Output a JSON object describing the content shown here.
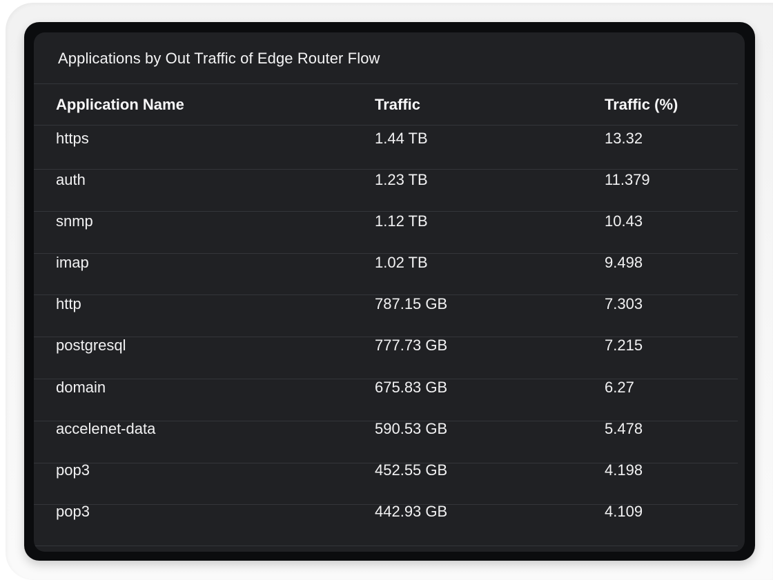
{
  "widget": {
    "title": "Applications by Out Traffic of Edge Router Flow"
  },
  "table": {
    "headers": {
      "name": "Application Name",
      "traffic": "Traffic",
      "percent": "Traffic (%)"
    },
    "rows": [
      {
        "name": "https",
        "traffic": "1.44 TB",
        "percent": "13.32"
      },
      {
        "name": "auth",
        "traffic": "1.23 TB",
        "percent": "11.379"
      },
      {
        "name": "snmp",
        "traffic": "1.12 TB",
        "percent": "10.43"
      },
      {
        "name": "imap",
        "traffic": "1.02 TB",
        "percent": "9.498"
      },
      {
        "name": "http",
        "traffic": "787.15 GB",
        "percent": "7.303"
      },
      {
        "name": "postgresql",
        "traffic": "777.73 GB",
        "percent": "7.215"
      },
      {
        "name": "domain",
        "traffic": "675.83 GB",
        "percent": "6.27"
      },
      {
        "name": "accelenet-data",
        "traffic": "590.53 GB",
        "percent": "5.478"
      },
      {
        "name": "pop3",
        "traffic": "452.55 GB",
        "percent": "4.198"
      },
      {
        "name": "pop3",
        "traffic": "442.93 GB",
        "percent": "4.109"
      }
    ]
  },
  "colors": {
    "panel_background": "#202124",
    "frame": "#0b0c0e",
    "divider": "#34363a",
    "text": "#f2f2f3"
  }
}
